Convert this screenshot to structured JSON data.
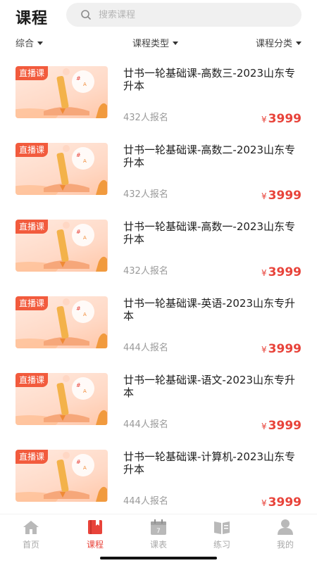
{
  "header": {
    "title": "课程",
    "search_placeholder": "搜索课程"
  },
  "filters": [
    {
      "label": "综合"
    },
    {
      "label": "课程类型"
    },
    {
      "label": "课程分类"
    }
  ],
  "courses": [
    {
      "badge": "直播课",
      "title": "廿书一轮基础课-高数三-2023山东专升本",
      "enrolled": "432人报名",
      "price": "3999",
      "currency": "¥"
    },
    {
      "badge": "直播课",
      "title": "廿书一轮基础课-高数二-2023山东专升本",
      "enrolled": "432人报名",
      "price": "3999",
      "currency": "¥"
    },
    {
      "badge": "直播课",
      "title": "廿书一轮基础课-高数一-2023山东专升本",
      "enrolled": "432人报名",
      "price": "3999",
      "currency": "¥"
    },
    {
      "badge": "直播课",
      "title": "廿书一轮基础课-英语-2023山东专升本",
      "enrolled": "444人报名",
      "price": "3999",
      "currency": "¥"
    },
    {
      "badge": "直播课",
      "title": "廿书一轮基础课-语文-2023山东专升本",
      "enrolled": "444人报名",
      "price": "3999",
      "currency": "¥"
    },
    {
      "badge": "直播课",
      "title": "廿书一轮基础课-计算机-2023山东专升本",
      "enrolled": "444人报名",
      "price": "3999",
      "currency": "¥"
    }
  ],
  "nav": [
    {
      "label": "首页",
      "icon": "home-icon",
      "active": false
    },
    {
      "label": "课程",
      "icon": "book-icon",
      "active": true
    },
    {
      "label": "课表",
      "icon": "calendar-icon",
      "active": false
    },
    {
      "label": "练习",
      "icon": "practice-icon",
      "active": false
    },
    {
      "label": "我的",
      "icon": "profile-icon",
      "active": false
    }
  ],
  "colors": {
    "accent": "#e8433a",
    "badge": "#f25b3d",
    "inactive": "#a9a9a9"
  }
}
